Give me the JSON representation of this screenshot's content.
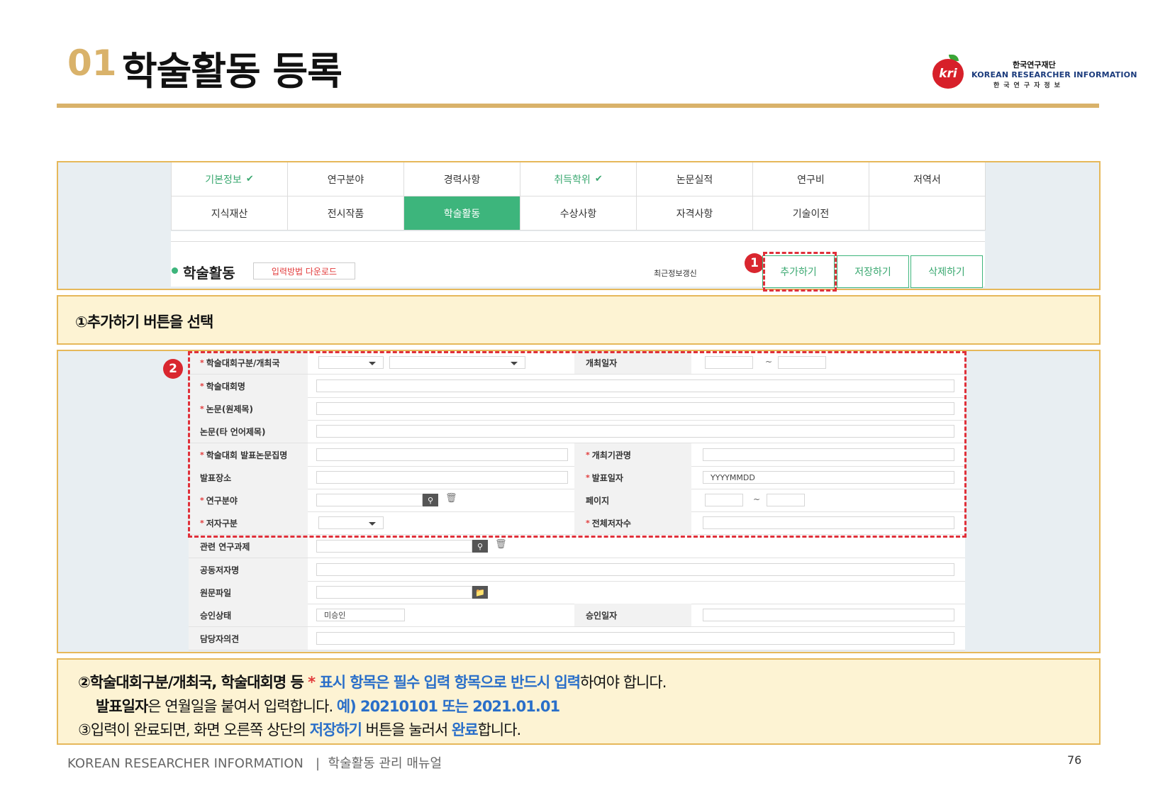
{
  "header": {
    "number": "01",
    "title": "학술활동 등록",
    "logo": {
      "badge": "kri",
      "korean_name": "한국연구재단",
      "english_name": "KOREAN RESEARCHER INFORMATION",
      "korean_spaced": "한국연구자정보"
    }
  },
  "tabs_row1": [
    {
      "label": "기본정보",
      "check": "✔",
      "state": "completed"
    },
    {
      "label": "연구분야",
      "state": "normal"
    },
    {
      "label": "경력사항",
      "state": "normal"
    },
    {
      "label": "취득학위",
      "check": "✔",
      "state": "completed"
    },
    {
      "label": "논문실적",
      "state": "normal"
    },
    {
      "label": "연구비",
      "state": "normal"
    },
    {
      "label": "저역서",
      "state": "normal"
    }
  ],
  "tabs_row2": [
    {
      "label": "지식재산",
      "state": "normal"
    },
    {
      "label": "전시작품",
      "state": "normal"
    },
    {
      "label": "학술활동",
      "state": "active"
    },
    {
      "label": "수상사항",
      "state": "normal"
    },
    {
      "label": "자격사항",
      "state": "normal"
    },
    {
      "label": "기술이전",
      "state": "normal"
    },
    {
      "label": "",
      "state": "normal"
    }
  ],
  "section": {
    "title": "학술활동",
    "download_label": "입력방법 다운로드",
    "recent_update": "최근정보갱신",
    "add_label": "추가하기",
    "save_label": "저장하기",
    "delete_label": "삭제하기"
  },
  "badges": {
    "one": "1",
    "two": "2"
  },
  "step1": "①추가하기 버튼을 선택",
  "form": {
    "labels": {
      "conf_type": "학술대회구분/개최국",
      "held_date": "개최일자",
      "conf_name": "학술대회명",
      "paper_title": "논문(원제목)",
      "paper_other": "논문(타 언어제목)",
      "proceedings": "학술대회 발표논문집명",
      "host_org": "개최기관명",
      "venue": "발표장소",
      "pres_date": "발표일자",
      "field": "연구분야",
      "page": "페이지",
      "author_type": "저자구분",
      "total_authors": "전체저자수",
      "project": "관련 연구과제",
      "coauthors": "공동저자명",
      "file": "원문파일",
      "approval_status": "승인상태",
      "approval_date": "승인일자",
      "manager_opinion": "담당자의견"
    },
    "required_mark": "*",
    "tilde": "~",
    "date_placeholder": "YYYYMMDD",
    "approval_value": "미승인"
  },
  "instructions": {
    "line1_a": "②학술대회구분/개최국, 학술대회명 등 ",
    "line1_star": "*",
    "line1_b": " 표시 항목은 필수 입력 항목으로 반드시 입력",
    "line1_c": "하여야 합니다.",
    "line2_a": "발표일자",
    "line2_b": "은 연월일을 붙여서 입력합니다. ",
    "line2_c": "예) 20210101 또는 2021.01.01",
    "line3_a": "③입력이 완료되면, 화면 오른쪽 상단의 ",
    "line3_b": "저장하기",
    "line3_c": " 버튼을 눌러서 ",
    "line3_d": "완료",
    "line3_e": "합니다."
  },
  "footer": {
    "left": "KOREAN RESEARCHER INFORMATION   |  학술활동 관리 매뉴얼",
    "page": "76"
  },
  "colors": {
    "gold": "#d9b26a",
    "green": "#3db57c",
    "red": "#e0303a",
    "blue": "#2a6fc9"
  }
}
